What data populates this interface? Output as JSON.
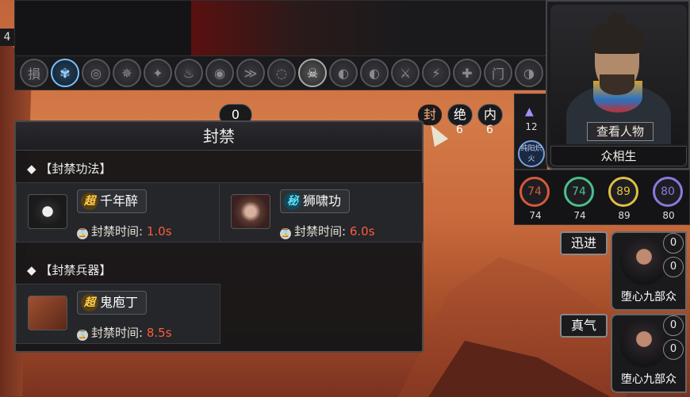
{
  "top": {
    "edge_num": "4"
  },
  "icon_row": [
    {
      "icon": "sun-icon",
      "glyph": "損"
    },
    {
      "icon": "lungs-icon",
      "glyph": "✾",
      "active": true
    },
    {
      "icon": "eye-rune-icon",
      "glyph": "◎"
    },
    {
      "icon": "star-rune-icon",
      "glyph": "✵"
    },
    {
      "icon": "fire-rune-icon",
      "glyph": "✦"
    },
    {
      "icon": "flame-icon",
      "glyph": "♨"
    },
    {
      "icon": "eye-icon",
      "glyph": "◉"
    },
    {
      "icon": "wind-icon",
      "glyph": "≫"
    },
    {
      "icon": "spiral-icon",
      "glyph": "◌"
    },
    {
      "icon": "skull-icon",
      "glyph": "☠",
      "white": true
    },
    {
      "icon": "split-icon",
      "glyph": "◐"
    },
    {
      "icon": "split-icon-2",
      "glyph": "◐"
    },
    {
      "icon": "sword-rune-icon",
      "glyph": "⚔"
    },
    {
      "icon": "claw-icon",
      "glyph": "⚡"
    },
    {
      "icon": "cross-icon",
      "glyph": "✚"
    },
    {
      "icon": "gate-icon",
      "glyph": "门"
    },
    {
      "icon": "mask-icon",
      "glyph": "◑"
    }
  ],
  "chips": {
    "left_count": "0",
    "seal": "封",
    "jue": "绝",
    "jue_num": "6",
    "nei": "内",
    "nei_num": "6"
  },
  "panel": {
    "title": "封禁",
    "section_skills": "【封禁功法】",
    "section_weapons": "【封禁兵器】",
    "time_label": "封禁时间:",
    "skills": [
      {
        "tag": "超",
        "name": "千年醉",
        "time": "1.0s",
        "tag_color": "#e0b030",
        "icon": "fox-mask-icon"
      },
      {
        "tag": "秘",
        "name": "狮啸功",
        "time": "6.0s",
        "tag_color": "#40c8e0",
        "icon": "lion-icon"
      }
    ],
    "weapons": [
      {
        "tag": "超",
        "name": "鬼庖丁",
        "time": "8.5s",
        "tag_color": "#e0b030",
        "icon": "cleaver-icon"
      }
    ]
  },
  "character": {
    "view_label": "查看人物",
    "name": "众相生",
    "side_num": "12",
    "side_badge": "纯阳炽火"
  },
  "stats": [
    {
      "ring": "74",
      "under": "74",
      "color": "#d85a3a"
    },
    {
      "ring": "74",
      "under": "74",
      "color": "#4ac08a"
    },
    {
      "ring": "89",
      "under": "89",
      "color": "#e0c040"
    },
    {
      "ring": "80",
      "under": "80",
      "color": "#8a7ae0"
    }
  ],
  "allies": [
    {
      "tag": "迅进",
      "name": "堕心九部众",
      "badge_top": "0",
      "badge_mid": "0"
    },
    {
      "tag": "真气",
      "name": "堕心九部众",
      "badge_top": "0",
      "badge_mid": "0"
    }
  ]
}
